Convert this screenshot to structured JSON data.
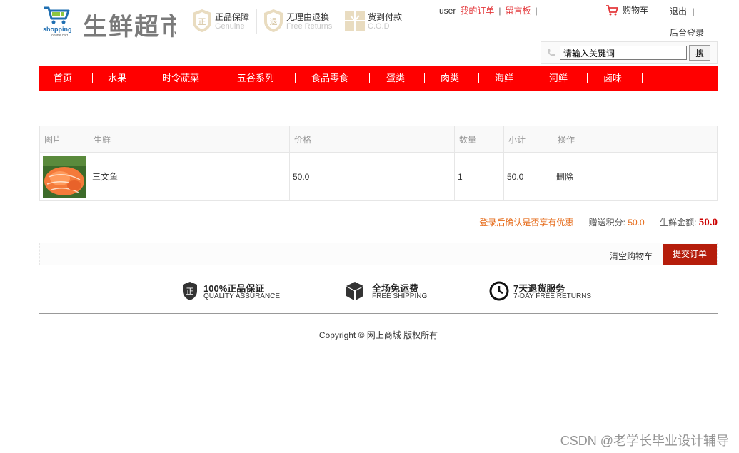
{
  "header": {
    "logo_text": "shopping",
    "logo_sub": "online cart",
    "site_title": "生鲜超市",
    "promises": [
      {
        "title": "正品保障",
        "subtitle": "Genuine",
        "icon": "genuine-seal-icon"
      },
      {
        "title": "无理由退换",
        "subtitle": "Free Returns",
        "icon": "returns-seal-icon"
      },
      {
        "title": "货到付款",
        "subtitle": "C.O.D",
        "icon": "cod-box-icon"
      }
    ]
  },
  "topbar": {
    "user": "user",
    "my_orders": "我的订单",
    "message_board": "留言板",
    "separator": "|",
    "cart": "购物车",
    "logout": "退出",
    "logout_sep": "|",
    "admin_login": "后台登录"
  },
  "search": {
    "value": "请输入关键词",
    "button": "搜"
  },
  "nav": {
    "items": [
      "首页",
      "水果",
      "时令蔬菜",
      "五谷系列",
      "食品零食",
      "蛋类",
      "肉类",
      "海鲜",
      "河鲜",
      "卤味"
    ],
    "separator": "|"
  },
  "cart": {
    "columns": [
      "图片",
      "生鲜",
      "价格",
      "数量",
      "小计",
      "操作"
    ],
    "rows": [
      {
        "name": "三文鱼",
        "price": "50.0",
        "quantity": "1",
        "subtotal": "50.0",
        "action": "删除"
      }
    ]
  },
  "summary": {
    "hint": "登录后确认是否享有优惠",
    "points_label": "赠送积分:",
    "points_value": "50.0",
    "total_label": "生鲜金额:",
    "total_value": "50.0"
  },
  "actions": {
    "clear": "清空购物车",
    "submit": "提交订单"
  },
  "services": [
    {
      "title": "100%正品保证",
      "subtitle": "QUALITY ASSURANCE",
      "icon": "shield-icon"
    },
    {
      "title": "全场免运费",
      "subtitle": "FREE SHIPPING",
      "icon": "box-icon"
    },
    {
      "title": "7天退货服务",
      "subtitle": "7-DAY FREE RETURNS",
      "icon": "clock-icon"
    }
  ],
  "footer": {
    "copyright": "Copyright © 网上商城 版权所有"
  },
  "watermark": "CSDN @老学长毕业设计辅导",
  "colors": {
    "nav_bg": "#ff0000",
    "submit_bg": "#b51d0b",
    "accent_orange": "#e66b1a",
    "link_red": "#e4393c"
  }
}
